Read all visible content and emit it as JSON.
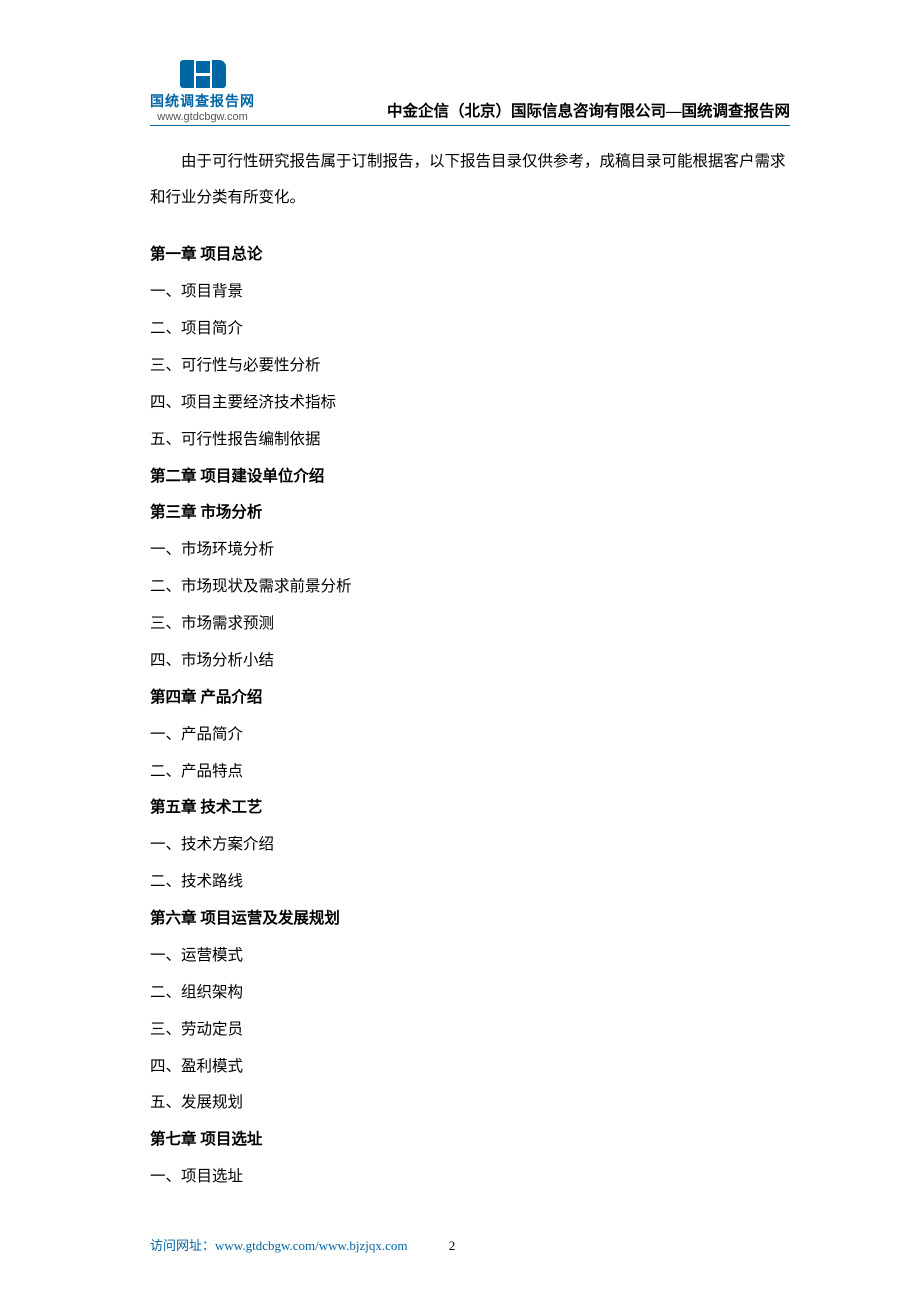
{
  "header": {
    "logo_label": "国统调查报告网",
    "logo_url": "www.gtdcbgw.com",
    "title": "中金企信（北京）国际信息咨询有限公司—国统调查报告网"
  },
  "intro": "由于可行性研究报告属于订制报告，以下报告目录仅供参考，成稿目录可能根据客户需求和行业分类有所变化。",
  "toc": [
    {
      "text": "第一章  项目总论",
      "bold": true
    },
    {
      "text": "一、项目背景",
      "bold": false
    },
    {
      "text": "二、项目简介",
      "bold": false
    },
    {
      "text": "三、可行性与必要性分析",
      "bold": false
    },
    {
      "text": "四、项目主要经济技术指标",
      "bold": false
    },
    {
      "text": "五、可行性报告编制依据",
      "bold": false
    },
    {
      "text": "第二章  项目建设单位介绍",
      "bold": true
    },
    {
      "text": "第三章  市场分析",
      "bold": true
    },
    {
      "text": "一、市场环境分析",
      "bold": false
    },
    {
      "text": "二、市场现状及需求前景分析",
      "bold": false
    },
    {
      "text": "三、市场需求预测",
      "bold": false
    },
    {
      "text": "四、市场分析小结",
      "bold": false
    },
    {
      "text": "第四章  产品介绍",
      "bold": true
    },
    {
      "text": "一、产品简介",
      "bold": false
    },
    {
      "text": "二、产品特点",
      "bold": false
    },
    {
      "text": "第五章  技术工艺",
      "bold": true
    },
    {
      "text": "一、技术方案介绍",
      "bold": false
    },
    {
      "text": "二、技术路线",
      "bold": false
    },
    {
      "text": "第六章  项目运营及发展规划",
      "bold": true
    },
    {
      "text": "一、运营模式",
      "bold": false
    },
    {
      "text": "二、组织架构",
      "bold": false
    },
    {
      "text": "三、劳动定员",
      "bold": false
    },
    {
      "text": "四、盈利模式",
      "bold": false
    },
    {
      "text": "五、发展规划",
      "bold": false
    },
    {
      "text": "第七章  项目选址",
      "bold": true
    },
    {
      "text": "一、项目选址",
      "bold": false
    }
  ],
  "footer": {
    "label": "访问网址：",
    "url": "www.gtdcbgw.com/www.bjzjqx.com",
    "page": "2"
  }
}
